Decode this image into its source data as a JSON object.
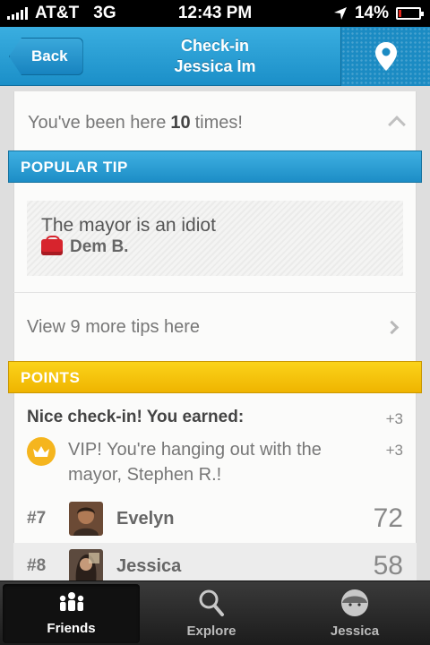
{
  "status_bar": {
    "carrier": "AT&T",
    "network": "3G",
    "time": "12:43 PM",
    "battery": "14%",
    "battery_level": 0.14,
    "icons": [
      "signal-bars-icon",
      "location-arrow-icon",
      "battery-icon"
    ]
  },
  "nav": {
    "back_label": "Back",
    "title_line1": "Check-in",
    "title_line2": "Jessica Im",
    "right_icon": "map-pin-icon"
  },
  "visits": {
    "prefix": "You've been here",
    "count": "10",
    "suffix": "times!"
  },
  "tips": {
    "header": "POPULAR TIP",
    "tip_text": "The mayor is an idiot",
    "tip_author": "Dem B.",
    "more_link": "View 9 more tips here"
  },
  "points": {
    "header": "POINTS",
    "earned_label": "Nice check-in! You earned:",
    "earned_value": "+3",
    "vip_text": "VIP! You're hanging out with the mayor, Stephen R.!",
    "vip_value": "+3"
  },
  "leaderboard": [
    {
      "rank": "#7",
      "name": "Evelyn",
      "score": "72"
    },
    {
      "rank": "#8",
      "name": "Jessica",
      "score": "58"
    }
  ],
  "tabs": [
    {
      "label": "Friends",
      "icon": "friends-icon",
      "active": true
    },
    {
      "label": "Explore",
      "icon": "search-icon",
      "active": false
    },
    {
      "label": "Jessica",
      "icon": "profile-icon",
      "active": false
    }
  ],
  "colors": {
    "nav_blue": "#1b8fc8",
    "points_yellow": "#f5c000",
    "tip_red": "#d7242d"
  }
}
